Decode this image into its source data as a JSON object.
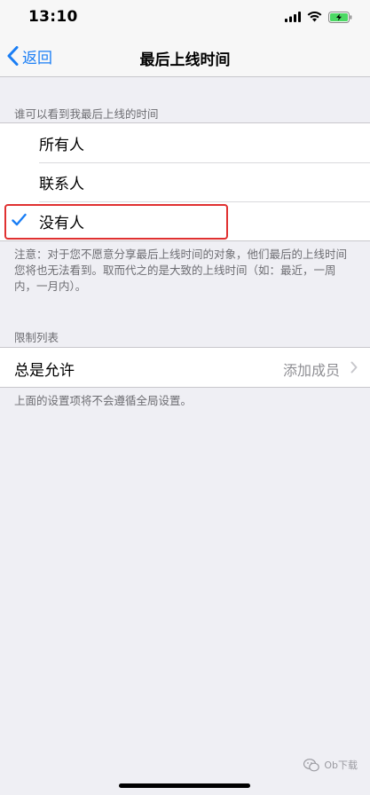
{
  "status_bar": {
    "time": "13:10",
    "icons": [
      "signal-icon",
      "wifi-icon",
      "battery-charging-icon"
    ],
    "battery_color": "#4cd964"
  },
  "nav": {
    "back_label": "返回",
    "title": "最后上线时间"
  },
  "visibility": {
    "header": "谁可以看到我最后上线的时间",
    "options": [
      {
        "label": "所有人",
        "checked": false
      },
      {
        "label": "联系人",
        "checked": false
      },
      {
        "label": "没有人",
        "checked": true
      }
    ],
    "note": "注意：对于您不愿意分享最后上线时间的对象，他们最后的上线时间您将也无法看到。取而代之的是大致的上线时间（如：最近，一周内，一月内）。"
  },
  "restrictions": {
    "header": "限制列表",
    "always_allow_label": "总是允许",
    "add_members_label": "添加成员",
    "footnote": "上面的设置项将不会遵循全局设置。"
  },
  "watermark": {
    "text": "Ob下载"
  },
  "colors": {
    "accent": "#1a7ef5",
    "highlight": "#e03131",
    "background": "#efeff4"
  }
}
